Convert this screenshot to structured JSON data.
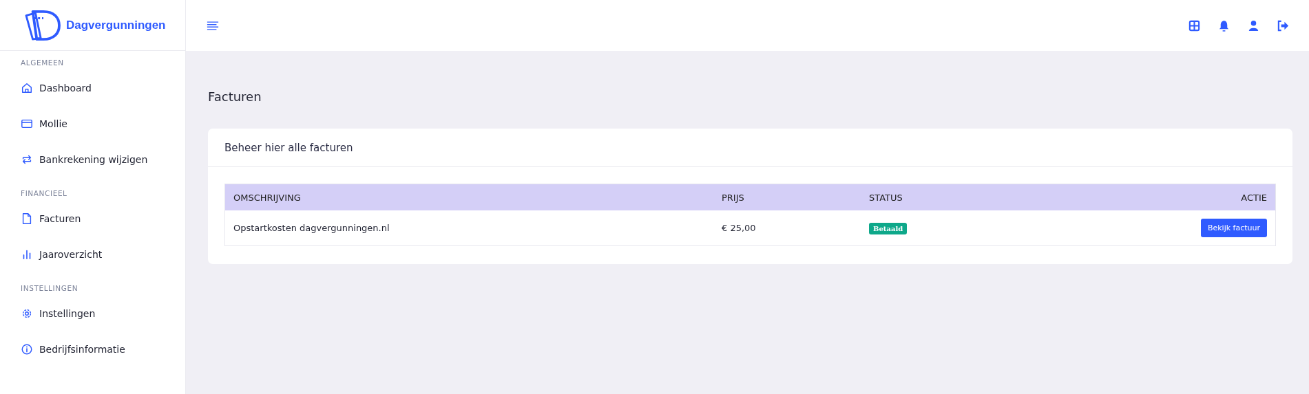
{
  "brand": {
    "name": "Dagvergunningen"
  },
  "sidebar": {
    "sections": [
      {
        "title": "ALGEMEEN",
        "items": [
          {
            "label": "Dashboard",
            "kind": "home"
          },
          {
            "label": "Mollie",
            "kind": "card"
          },
          {
            "label": "Bankrekening wijzigen",
            "kind": "swap"
          }
        ]
      },
      {
        "title": "FINANCIEEL",
        "items": [
          {
            "label": "Facturen",
            "kind": "file"
          },
          {
            "label": "Jaaroverzicht",
            "kind": "chart"
          }
        ]
      },
      {
        "title": "INSTELLINGEN",
        "items": [
          {
            "label": "Instellingen",
            "kind": "gear"
          },
          {
            "label": "Bedrijfsinformatie",
            "kind": "info"
          }
        ]
      }
    ]
  },
  "page": {
    "title": "Facturen"
  },
  "card": {
    "title": "Beheer hier alle facturen",
    "table": {
      "columns": [
        "OMSCHRIJVING",
        "PRIJS",
        "STATUS",
        "ACTIE"
      ],
      "rows": [
        {
          "description": "Opstartkosten dagvergunningen.nl",
          "price": "€ 25,00",
          "status": "Betaald",
          "action": "Bekijk factuur"
        }
      ]
    }
  }
}
